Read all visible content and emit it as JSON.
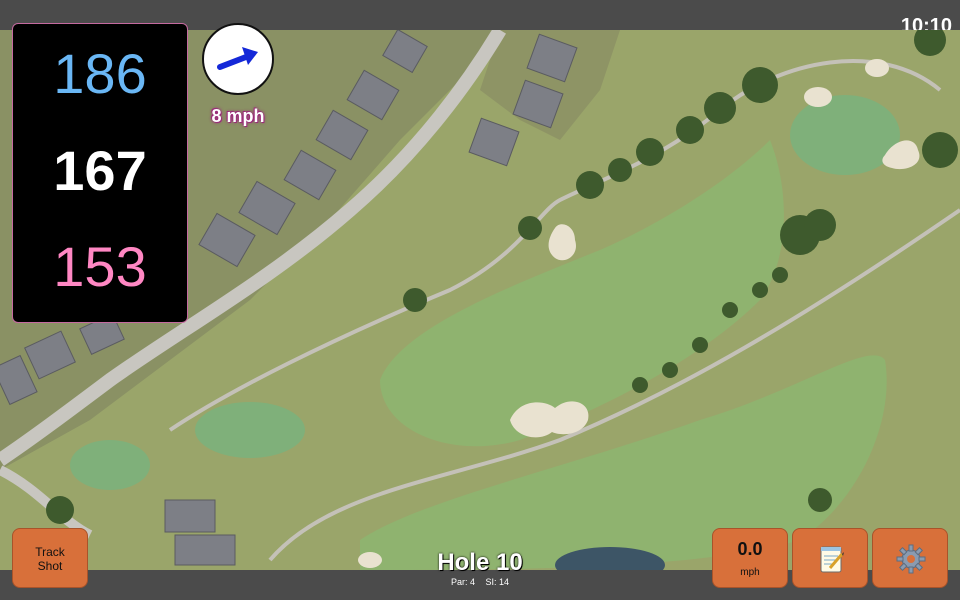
{
  "status": {
    "time": "10:10"
  },
  "distances": {
    "back": "186",
    "middle": "167",
    "front": "153"
  },
  "wind": {
    "speed": "8 mph",
    "icon": "wind-arrow-icon"
  },
  "buttons": {
    "track_shot": [
      "Track",
      "Shot"
    ],
    "speed_value": "0.0",
    "speed_unit": "mph",
    "notes_icon": "notepad-icon",
    "settings_icon": "gear-icon"
  },
  "hole": {
    "title": "Hole 10",
    "par": "Par: 4",
    "si": "SI: 14"
  },
  "colors": {
    "back": "#6ab7f5",
    "middle": "#ffffff",
    "front": "#ff87c3",
    "button": "#d8703a",
    "fairway": "#8fb36f",
    "green": "#7fb07a",
    "bunker": "#e9e2d0"
  }
}
